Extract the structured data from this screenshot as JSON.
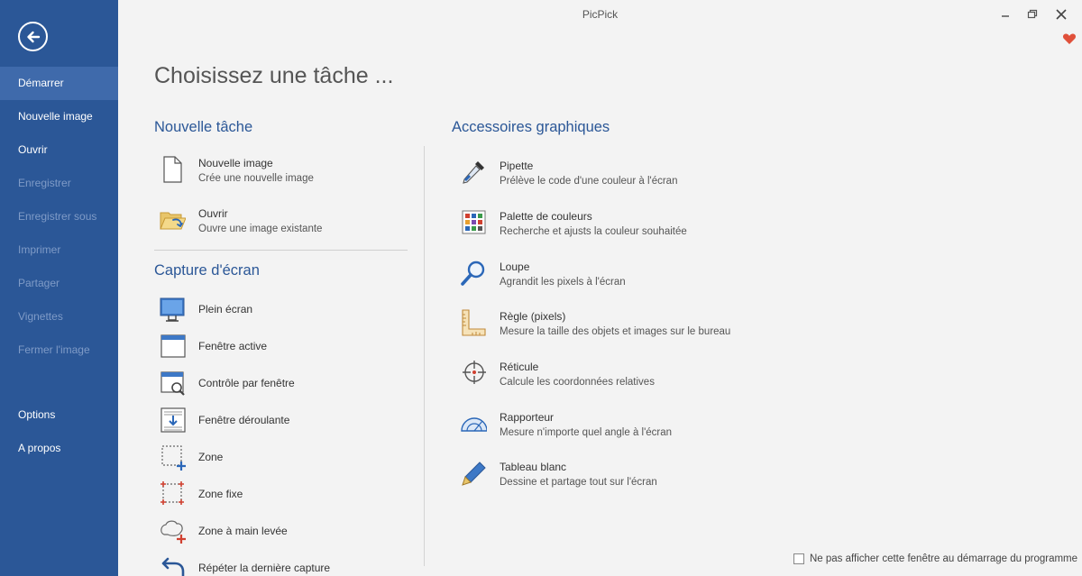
{
  "window": {
    "title": "PicPick"
  },
  "sidebar": {
    "items": [
      {
        "label": "Démarrer",
        "state": "active"
      },
      {
        "label": "Nouvelle image",
        "state": "enabled"
      },
      {
        "label": "Ouvrir",
        "state": "enabled"
      },
      {
        "label": "Enregistrer",
        "state": "disabled"
      },
      {
        "label": "Enregistrer sous",
        "state": "disabled"
      },
      {
        "label": "Imprimer",
        "state": "disabled"
      },
      {
        "label": "Partager",
        "state": "disabled"
      },
      {
        "label": "Vignettes",
        "state": "disabled"
      },
      {
        "label": "Fermer l'image",
        "state": "disabled"
      }
    ],
    "bottom_items": [
      {
        "label": "Options"
      },
      {
        "label": "A propos"
      }
    ]
  },
  "main": {
    "heading": "Choisissez une tâche ...",
    "new_task": {
      "title": "Nouvelle tâche",
      "items": [
        {
          "label": "Nouvelle image",
          "desc": "Crée une nouvelle image",
          "icon": "new-file-icon"
        },
        {
          "label": "Ouvrir",
          "desc": "Ouvre une image existante",
          "icon": "open-folder-icon"
        }
      ]
    },
    "capture": {
      "title": "Capture d'écran",
      "items": [
        {
          "label": "Plein écran",
          "icon": "monitor-icon"
        },
        {
          "label": "Fenêtre active",
          "icon": "window-icon"
        },
        {
          "label": "Contrôle par fenêtre",
          "icon": "window-magnify-icon"
        },
        {
          "label": "Fenêtre déroulante",
          "icon": "scroll-window-icon"
        },
        {
          "label": "Zone",
          "icon": "region-icon"
        },
        {
          "label": "Zone fixe",
          "icon": "fixed-region-icon"
        },
        {
          "label": "Zone à main levée",
          "icon": "freehand-icon"
        },
        {
          "label": "Répéter la dernière capture",
          "icon": "repeat-icon"
        }
      ]
    },
    "accessories": {
      "title": "Accessoires graphiques",
      "items": [
        {
          "label": "Pipette",
          "desc": "Prélève le code d'une couleur à l'écran",
          "icon": "eyedropper-icon"
        },
        {
          "label": "Palette de couleurs",
          "desc": "Recherche et ajusts la couleur souhaitée",
          "icon": "palette-icon"
        },
        {
          "label": "Loupe",
          "desc": "Agrandit les pixels à l'écran",
          "icon": "magnifier-icon"
        },
        {
          "label": "Règle (pixels)",
          "desc": "Mesure la taille des objets et images sur le bureau",
          "icon": "ruler-icon"
        },
        {
          "label": "Réticule",
          "desc": "Calcule les coordonnées relatives",
          "icon": "crosshair-icon"
        },
        {
          "label": "Rapporteur",
          "desc": "Mesure n'importe quel angle à l'écran",
          "icon": "protractor-icon"
        },
        {
          "label": "Tableau blanc",
          "desc": "Dessine et partage tout sur l'écran",
          "icon": "pen-icon"
        }
      ]
    }
  },
  "footer": {
    "checkbox_label": "Ne pas afficher cette fenêtre au démarrage du programme",
    "checked": false
  },
  "colors": {
    "sidebar_bg": "#2b5797",
    "sidebar_active": "#3f6aab",
    "accent_blue": "#2b5797",
    "heart": "#e0503a"
  }
}
